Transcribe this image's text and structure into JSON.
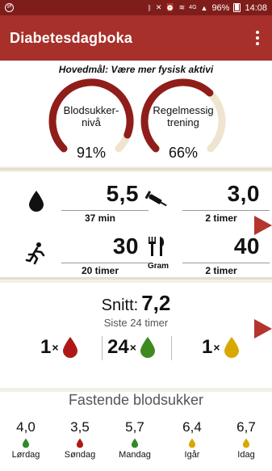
{
  "status_bar": {
    "battery": "96%",
    "time": "14:08",
    "network": "4G"
  },
  "app_bar": {
    "title": "Diabetesdagboka",
    "menu_icon": "more-vert-icon"
  },
  "goal": {
    "title": "Hovedmål: Være mer fysisk aktivi",
    "gauges": [
      {
        "label_line1": "Blodsukker-",
        "label_line2": "nivå",
        "percent_text": "91%",
        "progress": 0.91,
        "color": "#8f1e1b"
      },
      {
        "label_line1": "Regelmessig",
        "label_line2": "trening",
        "percent_text": "66%",
        "progress": 0.66,
        "color": "#8f1e1b"
      }
    ],
    "track_color": "#efe4cf"
  },
  "stats": {
    "glucose": {
      "icon": "blood-drop-icon",
      "value": "5,5",
      "unit": "37 min"
    },
    "insulin": {
      "icon": "syringe-icon",
      "value": "3,0",
      "unit": "2 timer"
    },
    "activity": {
      "icon": "running-person-icon",
      "value": "30",
      "unit": "20 timer"
    },
    "food": {
      "icon": "fork-knife-icon",
      "icon_label": "Gram",
      "value": "40",
      "unit": "2 timer"
    }
  },
  "average": {
    "label": "Snitt:",
    "value": "7,2",
    "period": "Siste 24 timer",
    "counts": [
      {
        "n": "1",
        "x": "×",
        "color": "#b01818"
      },
      {
        "n": "24",
        "x": "×",
        "color": "#3e8a1e"
      },
      {
        "n": "1",
        "x": "×",
        "color": "#d9a800"
      }
    ]
  },
  "fasting": {
    "title": "Fastende blodsukker",
    "days": [
      {
        "value": "4,0",
        "day": "Lørdag",
        "color": "#2f8a2a"
      },
      {
        "value": "3,5",
        "day": "Søndag",
        "color": "#b01818"
      },
      {
        "value": "5,7",
        "day": "Mandag",
        "color": "#2f8a2a"
      },
      {
        "value": "6,4",
        "day": "Igår",
        "color": "#d9a800"
      },
      {
        "value": "6,7",
        "day": "Idag",
        "color": "#d9a800"
      }
    ]
  }
}
